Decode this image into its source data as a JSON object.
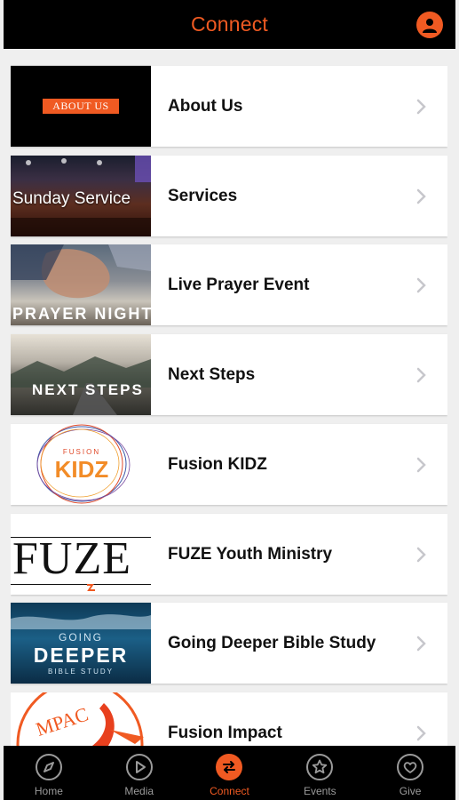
{
  "header": {
    "title": "Connect",
    "profile_icon": "profile-icon"
  },
  "colors": {
    "accent": "#f05a22",
    "bar": "#000000",
    "tab_inactive": "#9a9a9a"
  },
  "list": [
    {
      "label": "About Us",
      "thumb_text": "ABOUT US"
    },
    {
      "label": "Services",
      "thumb_text": "Sunday Service"
    },
    {
      "label": "Live Prayer Event",
      "thumb_text": "PRAYER NIGHT"
    },
    {
      "label": "Next Steps",
      "thumb_text": "NEXT STEPS"
    },
    {
      "label": "Fusion KIDZ",
      "thumb_text": "FUSION KIDZ"
    },
    {
      "label": "FUZE Youth Ministry",
      "thumb_text": "FUZE"
    },
    {
      "label": "Going Deeper Bible Study",
      "thumb_text_1": "GOING",
      "thumb_text_2": "DEEPER",
      "thumb_text_3": "BIBLE STUDY"
    },
    {
      "label": "Fusion Impact",
      "thumb_text": "IMPACT"
    }
  ],
  "tabs": [
    {
      "label": "Home",
      "icon": "compass-icon",
      "active": false
    },
    {
      "label": "Media",
      "icon": "play-icon",
      "active": false
    },
    {
      "label": "Connect",
      "icon": "swap-arrows-icon",
      "active": true
    },
    {
      "label": "Events",
      "icon": "star-icon",
      "active": false
    },
    {
      "label": "Give",
      "icon": "heart-icon",
      "active": false
    }
  ]
}
